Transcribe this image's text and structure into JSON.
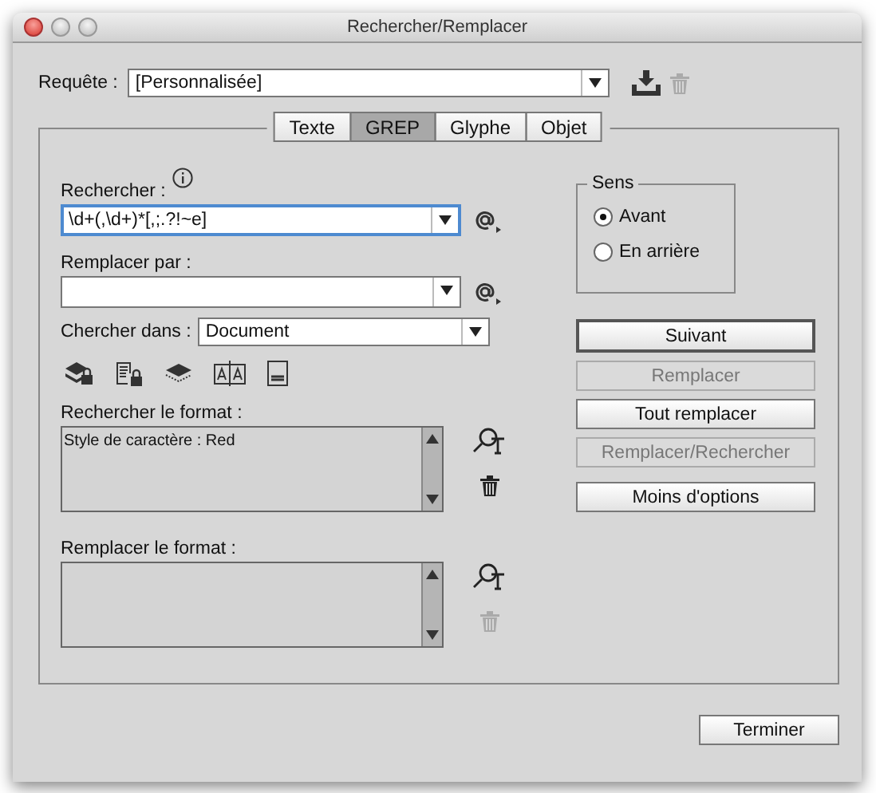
{
  "window": {
    "title": "Rechercher/Remplacer"
  },
  "query": {
    "label": "Requête :",
    "value": "[Personnalisée]",
    "delete_disabled": true
  },
  "tabs": [
    {
      "label": "Texte",
      "selected": false
    },
    {
      "label": "GREP",
      "selected": true
    },
    {
      "label": "Glyphe",
      "selected": false
    },
    {
      "label": "Objet",
      "selected": false
    }
  ],
  "find": {
    "label": "Rechercher :",
    "value": "\\d+(,\\d+)*[,;.?!~e]",
    "focused": true
  },
  "change": {
    "label": "Remplacer par :",
    "focused": false
  },
  "search_in": {
    "label": "Chercher dans :",
    "value": "Document"
  },
  "find_format": {
    "label": "Rechercher le format :",
    "value": "Style de caractère : Red",
    "delete_disabled": false
  },
  "change_format": {
    "label": "Remplacer le format :",
    "delete_disabled": true
  },
  "direction": {
    "label": "Sens",
    "options": [
      {
        "label": "Avant",
        "selected": true
      },
      {
        "label": "En arrière",
        "selected": false
      }
    ]
  },
  "buttons": [
    {
      "label": "Suivant",
      "disabled": false,
      "default": true
    },
    {
      "label": "Remplacer",
      "disabled": true,
      "default": false
    },
    {
      "label": "Tout remplacer",
      "disabled": false,
      "default": false
    },
    {
      "label": "Remplacer/Rechercher",
      "disabled": true,
      "default": false
    },
    {
      "label": "Moins d'options",
      "disabled": false,
      "default": false
    }
  ],
  "done_button": {
    "label": "Terminer"
  }
}
